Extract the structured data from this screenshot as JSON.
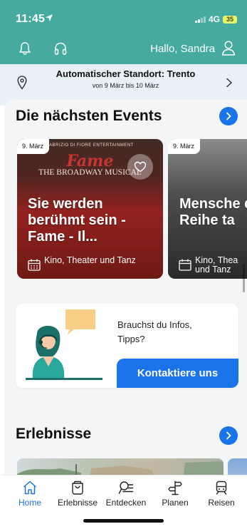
{
  "status_bar": {
    "time": "11:45",
    "network": "4G",
    "battery": "35"
  },
  "header": {
    "greeting": "Hallo, Sandra",
    "icons": [
      "bell-icon",
      "headphone-icon",
      "user-icon"
    ],
    "background_color": "#47aaa1"
  },
  "location": {
    "title": "Automatischer Standort: Trento",
    "subtitle": "von 9 März bis 10 März"
  },
  "events_section": {
    "title": "Die nächsten Events",
    "cards": [
      {
        "date": "9. März",
        "poster_top": "FABRIZIO DI FIORE ENTERTAINMENT",
        "poster_brand": "Fame",
        "poster_subtitle": "THE BROADWAY MUSICAL",
        "title": "Sie werden berühmt sein - Fame - Il...",
        "category": "Kino, Theater und Tanz"
      },
      {
        "date": "9. März",
        "title": "Mensche die aus d Reihe ta",
        "category": "Kino, Thea und Tanz"
      }
    ]
  },
  "help_card": {
    "question": "Brauchst du Infos, Tipps?",
    "button_label": "Kontaktiere uns"
  },
  "experiences_section": {
    "title": "Erlebnisse"
  },
  "tabbar": {
    "tabs": [
      {
        "label": "Home",
        "icon": "home-icon",
        "active": true
      },
      {
        "label": "Erlebnisse",
        "icon": "bag-icon",
        "active": false
      },
      {
        "label": "Entdecken",
        "icon": "discover-icon",
        "active": false
      },
      {
        "label": "Planen",
        "icon": "signpost-icon",
        "active": false
      },
      {
        "label": "Reisen",
        "icon": "train-icon",
        "active": false
      }
    ]
  },
  "colors": {
    "accent": "#1a73e8",
    "header": "#47aaa1",
    "location_strip": "#e7f1f6"
  }
}
